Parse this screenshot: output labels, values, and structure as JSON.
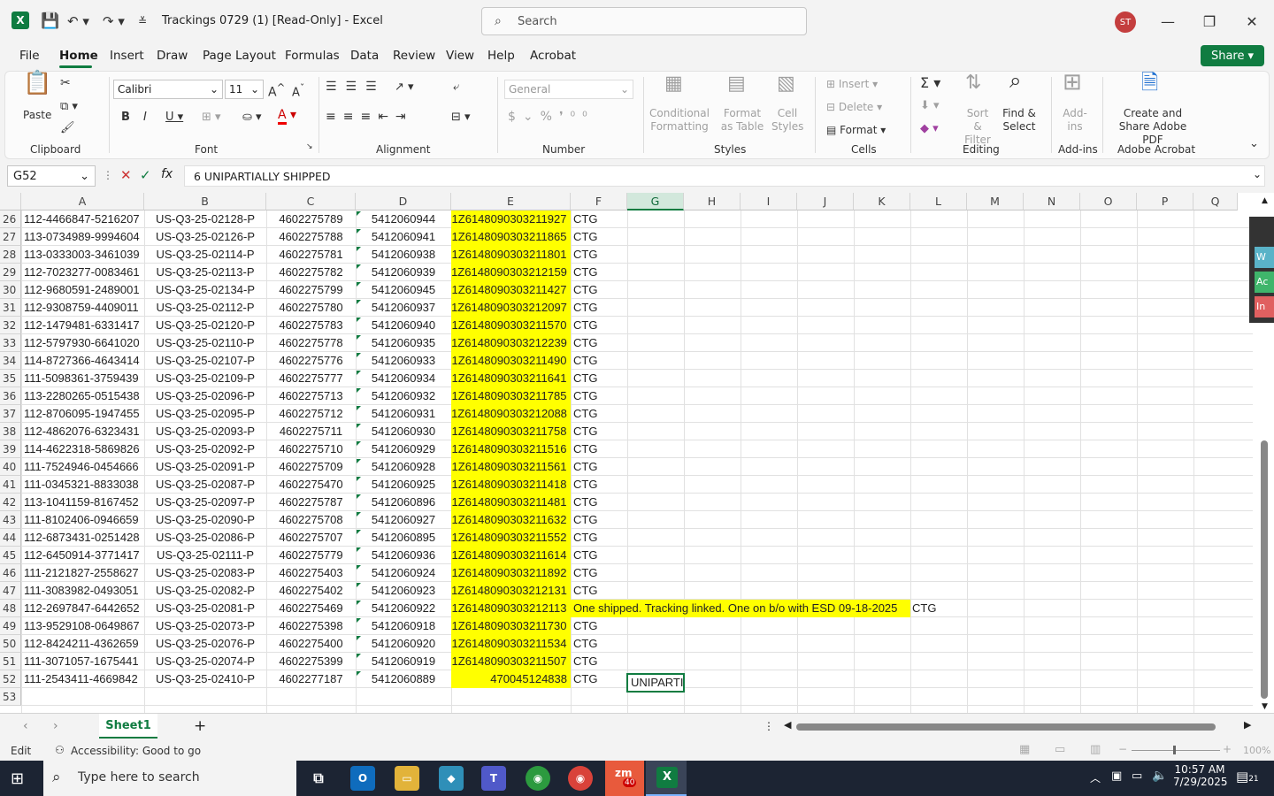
{
  "titlebar": {
    "title": "Trackings 0729 (1)  [Read-Only]  -  Excel",
    "search_placeholder": "Search",
    "avatar_initials": "ST"
  },
  "menu": [
    "File",
    "Home",
    "Insert",
    "Draw",
    "Page Layout",
    "Formulas",
    "Data",
    "Review",
    "View",
    "Help",
    "Acrobat"
  ],
  "share_label": "Share",
  "ribbon": {
    "clipboard": {
      "paste": "Paste",
      "label": "Clipboard"
    },
    "font": {
      "name": "Calibri",
      "size": "11",
      "label": "Font"
    },
    "alignment": {
      "label": "Alignment"
    },
    "number": {
      "format": "General",
      "label": "Number"
    },
    "styles": {
      "conditional": "Conditional Formatting",
      "format_table": "Format as Table",
      "cell_styles": "Cell Styles",
      "label": "Styles"
    },
    "cells": {
      "insert": "Insert",
      "delete": "Delete",
      "format": "Format",
      "label": "Cells"
    },
    "editing": {
      "sort": "Sort & Filter",
      "find": "Find & Select",
      "label": "Editing"
    },
    "addins": {
      "button": "Add-ins",
      "label": "Add-ins"
    },
    "acrobat": {
      "button": "Create and Share Adobe PDF",
      "label": "Adobe Acrobat"
    }
  },
  "formula_bar": {
    "name_box": "G52",
    "content": "6 UNIPARTIALLY SHIPPED"
  },
  "columns": [
    "A",
    "B",
    "C",
    "D",
    "E",
    "F",
    "G",
    "H",
    "I",
    "J",
    "K",
    "L",
    "M",
    "N",
    "O",
    "P",
    "Q"
  ],
  "rows": [
    {
      "n": "26",
      "a": "112-4466847-5216207",
      "b": "US-Q3-25-02128-P",
      "c": "4602275789",
      "d": "5412060944",
      "e": "1Z6148090303211927",
      "f": "CTG"
    },
    {
      "n": "27",
      "a": "113-0734989-9994604",
      "b": "US-Q3-25-02126-P",
      "c": "4602275788",
      "d": "5412060941",
      "e": "1Z6148090303211865",
      "f": "CTG"
    },
    {
      "n": "28",
      "a": "113-0333003-3461039",
      "b": "US-Q3-25-02114-P",
      "c": "4602275781",
      "d": "5412060938",
      "e": "1Z6148090303211801",
      "f": "CTG"
    },
    {
      "n": "29",
      "a": "112-7023277-0083461",
      "b": "US-Q3-25-02113-P",
      "c": "4602275782",
      "d": "5412060939",
      "e": "1Z6148090303212159",
      "f": "CTG"
    },
    {
      "n": "30",
      "a": "112-9680591-2489001",
      "b": "US-Q3-25-02134-P",
      "c": "4602275799",
      "d": "5412060945",
      "e": "1Z6148090303211427",
      "f": "CTG"
    },
    {
      "n": "31",
      "a": "112-9308759-4409011",
      "b": "US-Q3-25-02112-P",
      "c": "4602275780",
      "d": "5412060937",
      "e": "1Z6148090303212097",
      "f": "CTG"
    },
    {
      "n": "32",
      "a": "112-1479481-6331417",
      "b": "US-Q3-25-02120-P",
      "c": "4602275783",
      "d": "5412060940",
      "e": "1Z6148090303211570",
      "f": "CTG"
    },
    {
      "n": "33",
      "a": "112-5797930-6641020",
      "b": "US-Q3-25-02110-P",
      "c": "4602275778",
      "d": "5412060935",
      "e": "1Z6148090303212239",
      "f": "CTG"
    },
    {
      "n": "34",
      "a": "114-8727366-4643414",
      "b": "US-Q3-25-02107-P",
      "c": "4602275776",
      "d": "5412060933",
      "e": "1Z6148090303211490",
      "f": "CTG"
    },
    {
      "n": "35",
      "a": "111-5098361-3759439",
      "b": "US-Q3-25-02109-P",
      "c": "4602275777",
      "d": "5412060934",
      "e": "1Z6148090303211641",
      "f": "CTG"
    },
    {
      "n": "36",
      "a": "113-2280265-0515438",
      "b": "US-Q3-25-02096-P",
      "c": "4602275713",
      "d": "5412060932",
      "e": "1Z6148090303211785",
      "f": "CTG"
    },
    {
      "n": "37",
      "a": "112-8706095-1947455",
      "b": "US-Q3-25-02095-P",
      "c": "4602275712",
      "d": "5412060931",
      "e": "1Z6148090303212088",
      "f": "CTG"
    },
    {
      "n": "38",
      "a": "112-4862076-6323431",
      "b": "US-Q3-25-02093-P",
      "c": "4602275711",
      "d": "5412060930",
      "e": "1Z6148090303211758",
      "f": "CTG"
    },
    {
      "n": "39",
      "a": "114-4622318-5869826",
      "b": "US-Q3-25-02092-P",
      "c": "4602275710",
      "d": "5412060929",
      "e": "1Z6148090303211516",
      "f": "CTG"
    },
    {
      "n": "40",
      "a": "111-7524946-0454666",
      "b": "US-Q3-25-02091-P",
      "c": "4602275709",
      "d": "5412060928",
      "e": "1Z6148090303211561",
      "f": "CTG"
    },
    {
      "n": "41",
      "a": "111-0345321-8833038",
      "b": "US-Q3-25-02087-P",
      "c": "4602275470",
      "d": "5412060925",
      "e": "1Z6148090303211418",
      "f": "CTG"
    },
    {
      "n": "42",
      "a": "113-1041159-8167452",
      "b": "US-Q3-25-02097-P",
      "c": "4602275787",
      "d": "5412060896",
      "e": "1Z6148090303211481",
      "f": "CTG"
    },
    {
      "n": "43",
      "a": "111-8102406-0946659",
      "b": "US-Q3-25-02090-P",
      "c": "4602275708",
      "d": "5412060927",
      "e": "1Z6148090303211632",
      "f": "CTG"
    },
    {
      "n": "44",
      "a": "112-6873431-0251428",
      "b": "US-Q3-25-02086-P",
      "c": "4602275707",
      "d": "5412060895",
      "e": "1Z6148090303211552",
      "f": "CTG"
    },
    {
      "n": "45",
      "a": "112-6450914-3771417",
      "b": "US-Q3-25-02111-P",
      "c": "4602275779",
      "d": "5412060936",
      "e": "1Z6148090303211614",
      "f": "CTG"
    },
    {
      "n": "46",
      "a": "111-2121827-2558627",
      "b": "US-Q3-25-02083-P",
      "c": "4602275403",
      "d": "5412060924",
      "e": "1Z6148090303211892",
      "f": "CTG"
    },
    {
      "n": "47",
      "a": "111-3083982-0493051",
      "b": "US-Q3-25-02082-P",
      "c": "4602275402",
      "d": "5412060923",
      "e": "1Z6148090303212131",
      "f": "CTG"
    },
    {
      "n": "48",
      "a": "112-2697847-6442652",
      "b": "US-Q3-25-02081-P",
      "c": "4602275469",
      "d": "5412060922",
      "e": "1Z6148090303212113",
      "f": "One shipped. Tracking linked. One on b/o with ESD 09-18-2025",
      "l": "CTG"
    },
    {
      "n": "49",
      "a": "113-9529108-0649867",
      "b": "US-Q3-25-02073-P",
      "c": "4602275398",
      "d": "5412060918",
      "e": "1Z6148090303211730",
      "f": "CTG"
    },
    {
      "n": "50",
      "a": "112-8424211-4362659",
      "b": "US-Q3-25-02076-P",
      "c": "4602275400",
      "d": "5412060920",
      "e": "1Z6148090303211534",
      "f": "CTG"
    },
    {
      "n": "51",
      "a": "111-3071057-1675441",
      "b": "US-Q3-25-02074-P",
      "c": "4602275399",
      "d": "5412060919",
      "e": "1Z6148090303211507",
      "f": "CTG"
    },
    {
      "n": "52",
      "a": "111-2543411-4669842",
      "b": "US-Q3-25-02410-P",
      "c": "4602277187",
      "d": "5412060889",
      "e": "470045124838",
      "f": "CTG",
      "g": "UNIPARTI"
    },
    {
      "n": "53",
      "a": "",
      "b": "",
      "c": "",
      "d": "",
      "e": "",
      "f": ""
    }
  ],
  "sheet_tab": "Sheet1",
  "status": {
    "mode": "Edit",
    "accessibility": "Accessibility: Good to go",
    "zoom": "100%"
  },
  "side_panel": [
    "W",
    "Ac",
    "In"
  ],
  "taskbar": {
    "search_placeholder": "Type here to search",
    "time": "10:57 AM",
    "date": "7/29/2025",
    "notif_count": "21",
    "zoom_badge": "40"
  },
  "colors": {
    "accent": "#107c41",
    "highlight": "#ffff00"
  }
}
